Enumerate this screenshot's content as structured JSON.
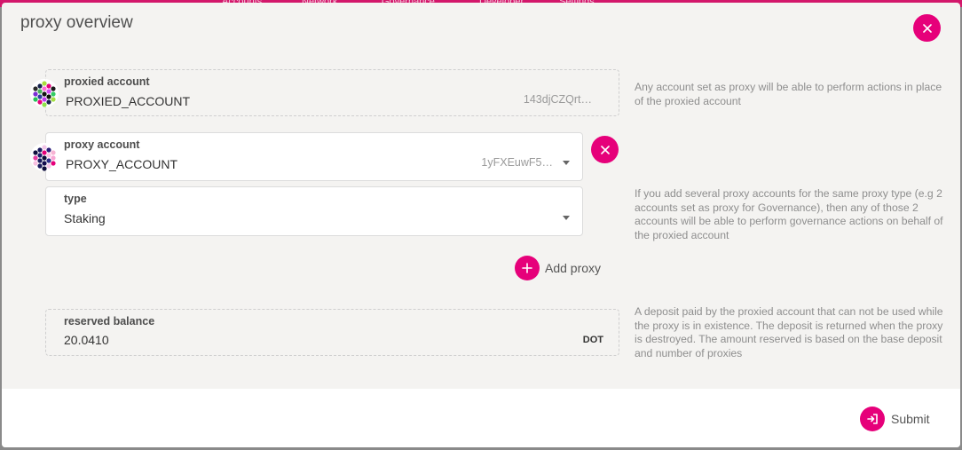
{
  "colors": {
    "accent": "#e6007a",
    "modal_bg": "#f4f3f1",
    "footer_bg": "#ffffff"
  },
  "background_tabs": [
    "Accounts",
    "Network",
    "Governance",
    "Developer",
    "Settings"
  ],
  "modal": {
    "title": "proxy overview",
    "close_icon": "close-icon"
  },
  "proxied": {
    "label": "proxied account",
    "name": "PROXIED_ACCOUNT",
    "address": "143djCZQrt…",
    "help": "Any account set as proxy will be able to perform actions in place of the proxied account"
  },
  "proxy": {
    "label": "proxy account",
    "name": "PROXY_ACCOUNT",
    "address": "1yFXEuwF5…",
    "remove_icon": "close-icon"
  },
  "type": {
    "label": "type",
    "value": "Staking",
    "help": "If you add several proxy accounts for the same proxy type (e.g 2 accounts set as proxy for Governance), then any of those 2 accounts will be able to perform governance actions on behalf of the proxied account"
  },
  "add_proxy": {
    "label": "Add proxy",
    "icon": "plus-icon"
  },
  "reserved": {
    "label": "reserved balance",
    "value": "20.0410",
    "unit": "DOT",
    "help": "A deposit paid by the proxied account that can not be used while the proxy is in existence. The deposit is returned when the proxy is destroyed. The amount reserved is based on the base deposit and number of proxies"
  },
  "submit": {
    "label": "Submit",
    "icon": "sign-in-icon"
  }
}
